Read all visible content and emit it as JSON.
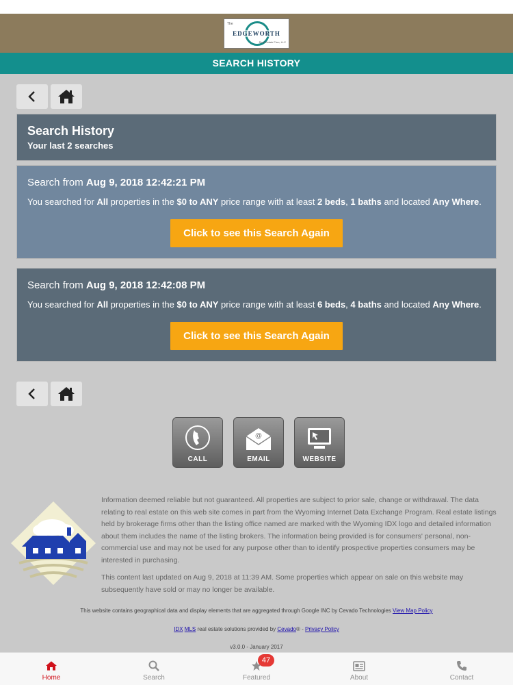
{
  "header": {
    "logo_text": "EDGEWORTH",
    "logo_tag": "The",
    "logo_sub": "Real Estate Firm, LLC",
    "page_title": "SEARCH HISTORY"
  },
  "history": {
    "title": "Search History",
    "subtitle": "Your last 2 searches",
    "searches": [
      {
        "prefix": "Search from ",
        "date": "Aug 9, 2018 12:42:21 PM",
        "desc_1": "You searched for ",
        "property_type": "All",
        "desc_2": " properties in the ",
        "price_range": "$0 to ANY",
        "desc_3": " price range with at least ",
        "beds": "2 beds",
        "sep": ", ",
        "baths": "1 baths",
        "desc_4": " and located ",
        "location": "Any Where",
        "end": ".",
        "button_label": "Click to see this Search Again"
      },
      {
        "prefix": "Search from ",
        "date": "Aug 9, 2018 12:42:08 PM",
        "desc_1": "You searched for ",
        "property_type": "All",
        "desc_2": " properties in the ",
        "price_range": "$0 to ANY",
        "desc_3": " price range with at least ",
        "beds": "6 beds",
        "sep": ", ",
        "baths": "4 baths",
        "desc_4": " and located ",
        "location": "Any Where",
        "end": ".",
        "button_label": "Click to see this Search Again"
      }
    ]
  },
  "contact": {
    "call_label": "CALL",
    "email_label": "EMAIL",
    "website_label": "WEBSITE"
  },
  "footer": {
    "disclaimer_1": "Information deemed reliable but not guaranteed. All properties are subject to prior sale, change or withdrawal. The data relating to real estate on this web site comes in part from the Wyoming Internet Data Exchange Program. Real estate listings held by brokerage firms other than the listing office named are marked with the Wyoming IDX logo and detailed information about them includes the name of the listing brokers. The information being provided is for consumers' personal, non-commercial use and may not be used for any purpose other than to identify prospective properties consumers may be interested in purchasing.",
    "disclaimer_2": "This content last updated on Aug 9, 2018 at 11:39 AM. Some properties which appear on sale on this website may subsequently have sold or may no longer be available.",
    "geo_text": "This website contains geographical data and display elements that are aggregated through Google INC by Cevado Technologies ",
    "map_policy_link": "View Map Policy",
    "idx_link": "IDX",
    "mls_link": "MLS",
    "solutions_text": " real estate solutions provided by ",
    "cevado_link": "Cevado",
    "reg_text": "® - ",
    "privacy_link": "Privacy Policy",
    "version": "v3.0.0 - January 2017"
  },
  "tabs": [
    {
      "label": "Home",
      "icon": "home-icon"
    },
    {
      "label": "Search",
      "icon": "search-icon"
    },
    {
      "label": "Featured",
      "icon": "star-icon",
      "badge": "47"
    },
    {
      "label": "About",
      "icon": "id-card-icon"
    },
    {
      "label": "Contact",
      "icon": "phone-icon"
    }
  ],
  "colors": {
    "brand_bar": "#8c7b5c",
    "title_bar": "#138f8d",
    "panel_dark": "#5b6b78",
    "panel_light": "#71879e",
    "button": "#f7a612",
    "active_tab": "#d0111b",
    "badge": "#e53935"
  }
}
